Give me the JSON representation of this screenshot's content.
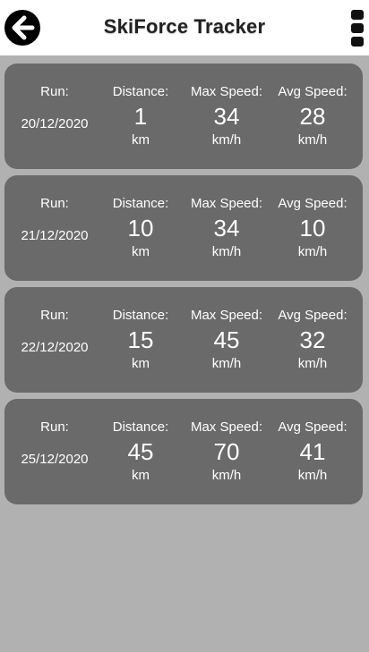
{
  "header": {
    "title": "SkiForce Tracker",
    "back_icon": "arrow-left-icon",
    "menu_icon": "vertical-menu-icon"
  },
  "labels": {
    "run": "Run:",
    "distance": "Distance:",
    "max_speed": "Max Speed:",
    "avg_speed": "Avg Speed:",
    "distance_unit": "km",
    "speed_unit": "km/h"
  },
  "runs": [
    {
      "date": "20/12/2020",
      "distance": "1",
      "max_speed": "34",
      "avg_speed": "28"
    },
    {
      "date": "21/12/2020",
      "distance": "10",
      "max_speed": "34",
      "avg_speed": "10"
    },
    {
      "date": "22/12/2020",
      "distance": "15",
      "max_speed": "45",
      "avg_speed": "32"
    },
    {
      "date": "25/12/2020",
      "distance": "45",
      "max_speed": "70",
      "avg_speed": "41"
    }
  ],
  "colors": {
    "header_bg": "#ffffff",
    "content_bg": "#b1b1b1",
    "card_bg": "#6a6a6a",
    "card_text": "#ffffff"
  }
}
